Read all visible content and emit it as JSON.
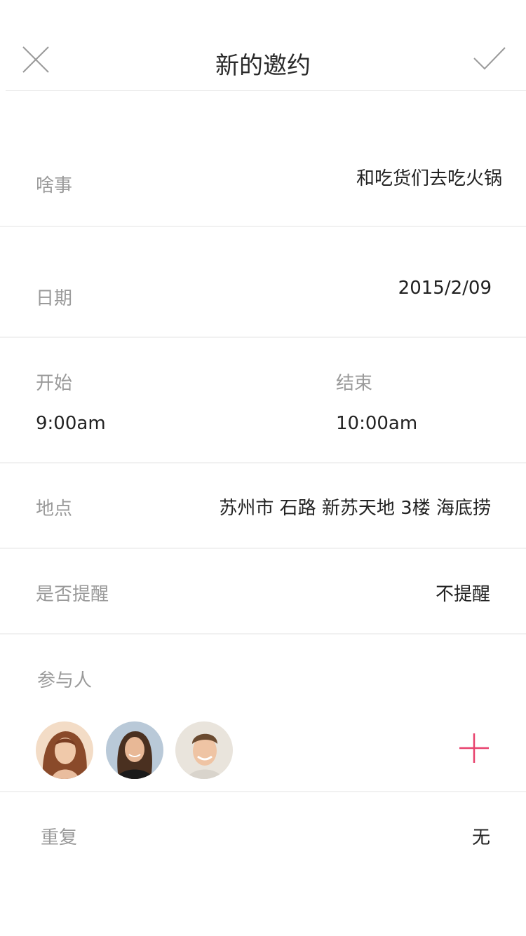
{
  "header": {
    "title": "新的邀约",
    "close_icon": "close-icon",
    "confirm_icon": "checkmark-icon"
  },
  "event": {
    "label": "啥事",
    "value": "和吃货们去吃火锅"
  },
  "date": {
    "label": "日期",
    "value": "2015/2/09"
  },
  "start": {
    "label": "开始",
    "value": "9:00am"
  },
  "end": {
    "label": "结束",
    "value": "10:00am"
  },
  "location": {
    "label": "地点",
    "value": "苏州市 石路 新苏天地 3楼 海底捞"
  },
  "reminder": {
    "label": "是否提醒",
    "value": "不提醒"
  },
  "participants": {
    "label": "参与人",
    "avatars": [
      "avatar-woman-red-hair",
      "avatar-woman-dark-hair",
      "avatar-man-smiling"
    ],
    "add_icon": "plus-icon"
  },
  "repeat": {
    "label": "重复",
    "value": "无"
  },
  "colors": {
    "accent": "#e8416d",
    "label": "#9a9a9a",
    "text": "#222222",
    "divider": "#f1f1f1"
  }
}
